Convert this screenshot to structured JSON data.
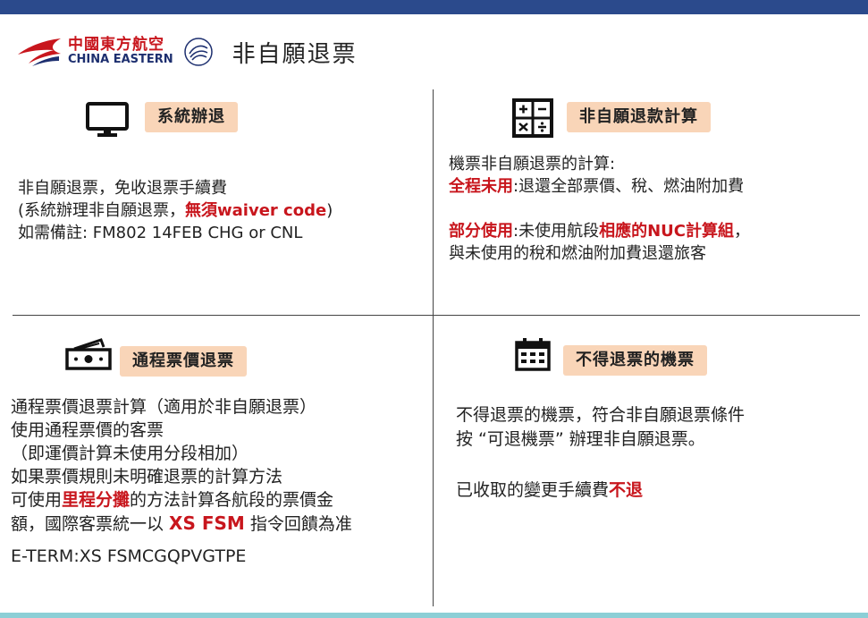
{
  "header": {
    "brand_cn": "中國東方航空",
    "brand_en": "CHINA EASTERN",
    "title": "非自願退票"
  },
  "q1": {
    "badge": "系統辦退",
    "line1": "非自願退票，免收退票手續費",
    "line2_a": "(系統辦理非自願退票，",
    "line2_b": "無須waiver code",
    "line2_c": ")",
    "line3": "如需備註: FM802 14FEB  CHG or CNL"
  },
  "q2": {
    "badge": "非自願退款計算",
    "line1": "機票非自願退票的計算:",
    "line2_a": "全程未用",
    "line2_b": ":退還全部票價、稅、燃油附加費",
    "line3_a": "部分使用",
    "line3_b": ":未使用航段",
    "line3_c": "相應的NUC計算組",
    "line3_d": "，",
    "line4": "與未使用的稅和燃油附加費退還旅客"
  },
  "q3": {
    "badge": "通程票價退票",
    "line1": "通程票價退票計算（適用於非自願退票）",
    "line2": "使用通程票價的客票",
    "line3": "（即運價計算未使用分段相加）",
    "line4": "如果票價規則未明確退票的計算方法",
    "line5_a": "可使用",
    "line5_b": "里程分攤",
    "line5_c": "的方法計算各航段的票價金",
    "line6_a": "額，國際客票統一以 ",
    "line6_b": "XS FSM",
    "line6_c": " 指令回饋為准",
    "line7": "E-TERM:XS FSMCGQPVGTPE"
  },
  "q4": {
    "badge": "不得退票的機票",
    "line1": "不得退票的機票，符合非自願退票條件",
    "line2": "按 “可退機票” 辦理非自願退票。",
    "line3_a": "已收取的變更手續費",
    "line3_b": "不退"
  },
  "colors": {
    "topbar": "#2b4a8c",
    "bottombar": "#8ccfd6",
    "badge": "#f9d5b8",
    "accent_red": "#c8161d"
  },
  "icons": {
    "logo": "china-eastern-swallow-logo",
    "skyteam": "skyteam-logo",
    "q1": "monitor-icon",
    "q2": "calculator-icon",
    "q3": "cash-icon",
    "q4": "calendar-icon"
  }
}
